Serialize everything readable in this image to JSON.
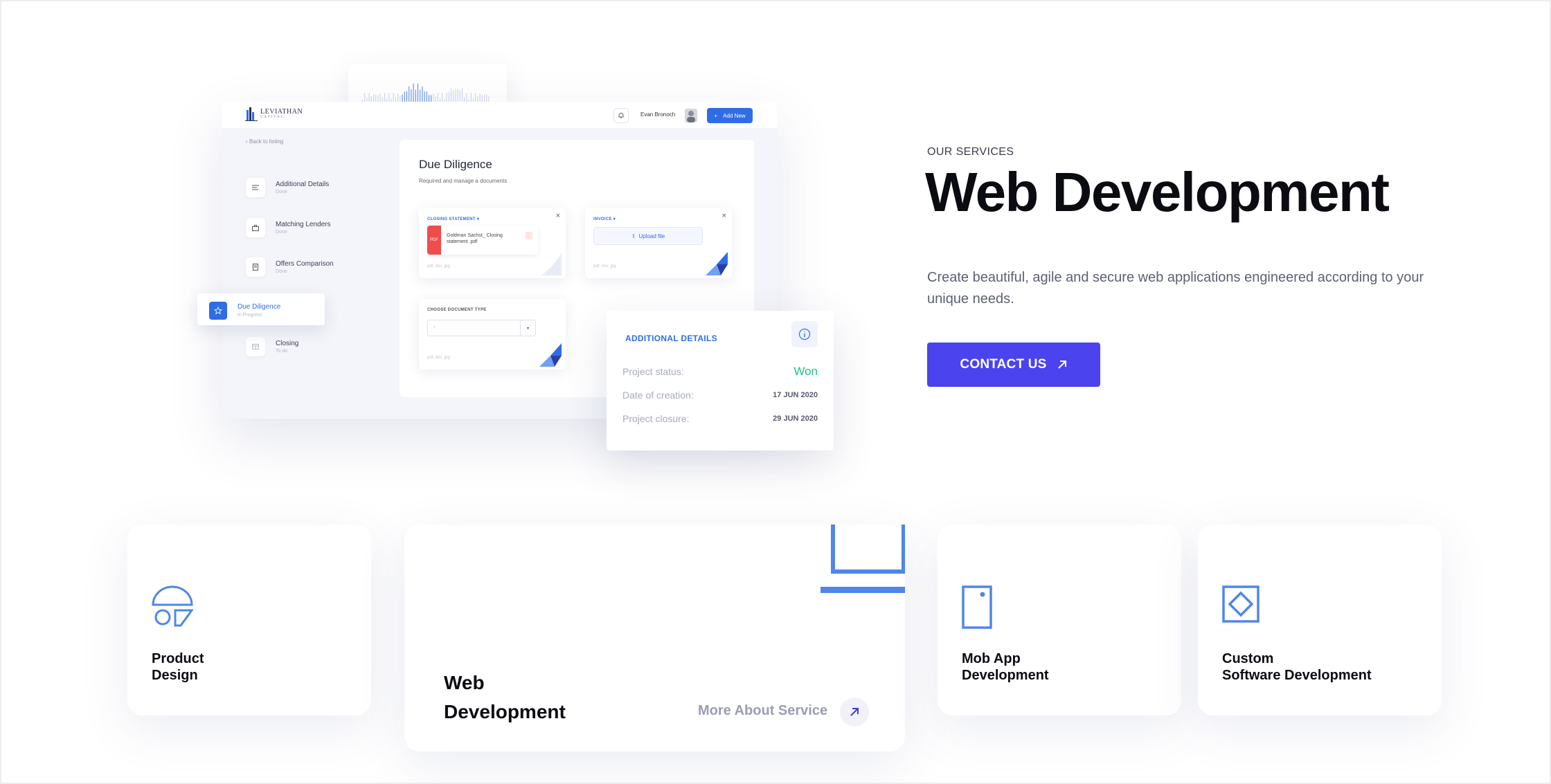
{
  "mockup": {
    "logo_text": "LEVIATHAN",
    "logo_sub": "CAPITAL",
    "user_name": "Evan Bronoch",
    "add_new_label": "Add New",
    "back_link": "Back to listing",
    "steps": [
      {
        "name": "Additional Details",
        "status": "Done"
      },
      {
        "name": "Matching Lenders",
        "status": "Done"
      },
      {
        "name": "Offers Comparison",
        "status": "Done"
      },
      {
        "name": "Due Diligence",
        "status": "In Progress"
      },
      {
        "name": "Closing",
        "status": "To do"
      }
    ],
    "due_diligence": {
      "title": "Due Diligence",
      "subtitle": "Required and manage a documents",
      "closing_statement_label": "CLOSING STATEMENT",
      "invoice_label": "INVOICE",
      "choose_type_label": "CHOOSE DOCUMENT TYPE",
      "file_type": "PDF",
      "file_name": "Goldman Sachst_ Closing statement .pdf",
      "upload_label": "Upload file",
      "formats": "pdf, doc, jpg",
      "select_value": "-"
    },
    "details_card": {
      "title": "ADDITIONAL DETAILS",
      "rows": [
        {
          "label": "Project status:",
          "value": "Won"
        },
        {
          "label": "Date of creation:",
          "value": "17 JUN 2020"
        },
        {
          "label": "Project closure:",
          "value": "29 JUN 2020"
        }
      ]
    }
  },
  "hero": {
    "eyebrow": "OUR SERVICES",
    "title": "Web Development",
    "description": "Create beautiful, agile and secure web applications engineered according to your unique needs.",
    "cta_label": "CONTACT US"
  },
  "services": [
    {
      "name": "Product\nDesign",
      "icon": "product-design-icon"
    },
    {
      "name": "Web\nDevelopment",
      "icon": "laptop-icon",
      "link_label": "More About Service"
    },
    {
      "name": "Mob App\nDevelopment",
      "icon": "mobile-icon"
    },
    {
      "name": "Custom\nSoftware Development",
      "icon": "diamond-icon"
    }
  ],
  "colors": {
    "accent": "#4b43ee",
    "mockup_blue": "#2f6de6",
    "icon_blue": "#4f86e8",
    "won_green": "#1fbf8f"
  }
}
